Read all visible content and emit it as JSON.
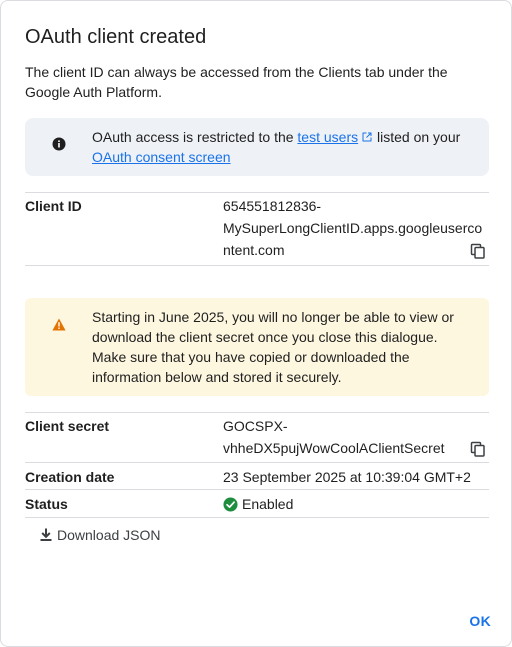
{
  "dialog": {
    "title": "OAuth client created",
    "intro": "The client ID can always be accessed from the Clients tab under the Google Auth Platform."
  },
  "info_notice": {
    "icon": "info-icon",
    "text_before": "OAuth access is restricted to the ",
    "test_users_link": "test users",
    "text_middle": " listed on your ",
    "consent_link": "OAuth consent screen"
  },
  "client_id": {
    "label": "Client ID",
    "value_line1": "654551812836-",
    "value_line2": "MySuperLongClientID.apps.googleuserco",
    "value_line3": "ntent.com"
  },
  "warning_notice": {
    "icon": "warning-icon",
    "text": "Starting in June 2025, you will no longer be able to view or download the client secret once you close this dialogue. Make sure that you have copied or downloaded the information below and stored it securely."
  },
  "client_secret": {
    "label": "Client secret",
    "value_line1": "GOCSPX-",
    "value_line2": "vhheDX5pujWowCoolAClientSecret"
  },
  "creation_date": {
    "label": "Creation date",
    "value": "23 September 2025 at 10:39:04 GMT+2"
  },
  "status": {
    "label": "Status",
    "value": "Enabled",
    "color": "#1e8e3e"
  },
  "actions": {
    "download_label": "Download JSON",
    "ok_label": "OK"
  },
  "colors": {
    "link": "#1a73e8",
    "info_bg": "#eef1f6",
    "warning_bg": "#fef7e0",
    "warning_icon": "#e37400"
  }
}
